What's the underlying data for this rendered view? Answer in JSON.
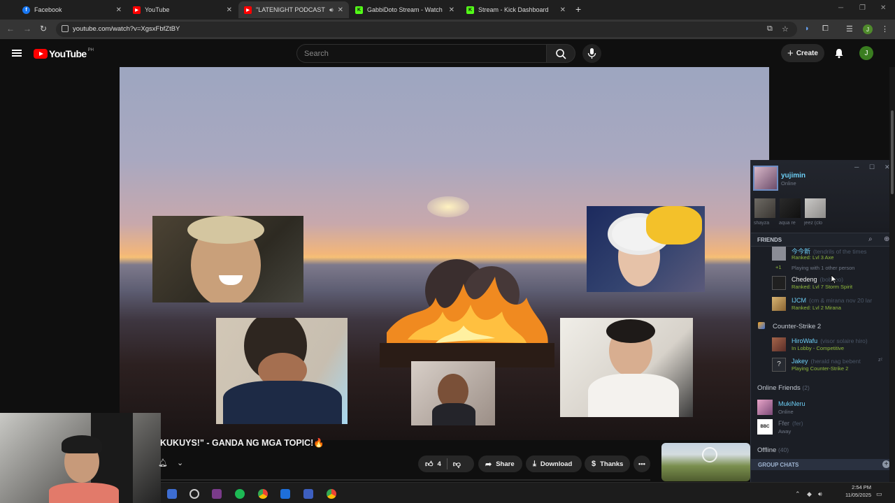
{
  "browser": {
    "tabs": [
      {
        "title": "Facebook",
        "color": "#1877f2",
        "glyph": "f"
      },
      {
        "title": "YouTube",
        "color": "#ff0000",
        "glyph": "▶"
      },
      {
        "title": "\"LATENIGHT PODCAST wit",
        "color": "#ff0000",
        "glyph": "▶"
      },
      {
        "title": "GabbiDoto Stream - Watch Liv",
        "color": "#53fc18",
        "glyph": "K"
      },
      {
        "title": "Stream - Kick Dashboard",
        "color": "#53fc18",
        "glyph": "K"
      }
    ],
    "url": "youtube.com/watch?v=XgsxFbfZtBY",
    "profile_initial": "J"
  },
  "youtube": {
    "country_code": "PH",
    "logo_text": "YouTube",
    "search_placeholder": "Search",
    "create_label": "Create",
    "avatar_initial": "J",
    "video_title": "KUKUYS!\" - GANDA NG MGA TOPIC!🔥",
    "like_count": "4",
    "share_label": "Share",
    "download_label": "Download",
    "thanks_label": "Thanks"
  },
  "steam": {
    "user": {
      "name": "yujimin",
      "status": "Online"
    },
    "recent": [
      "shayza",
      "aqua re",
      "jeez (clo"
    ],
    "friends_label": "FRIENDS",
    "in_game_rows": [
      {
        "name": "今今新",
        "nick": "(tendrils of the times",
        "status": "Ranked: Lvl 3 Axe"
      },
      {
        "extra": "+1",
        "note": "Playing with 1 other person"
      },
      {
        "name": "Chedeng",
        "nick": "(bob leo)",
        "status": "Ranked: Lvl 7 Storm Spirit"
      },
      {
        "name": "IJCM",
        "nick": "(cm & mirana nov 20 lar",
        "status": "Ranked: Lvl 2 Mirana"
      }
    ],
    "cs_group": "Counter-Strike 2",
    "cs_rows": [
      {
        "name": "HiroWafu",
        "nick": "(visor solaire hiro)",
        "status": "In Lobby - Competitive"
      },
      {
        "name": "Jakey",
        "nick": "(herald nag bebent",
        "status": "Playing Counter-Strike 2"
      }
    ],
    "online_group": "Online Friends",
    "online_count": "(2)",
    "online_rows": [
      {
        "name": "MukiNeru",
        "status": "Online"
      },
      {
        "name": "Ffer",
        "nick": "(fer)",
        "status": "Away"
      }
    ],
    "offline_group": "Offline",
    "offline_count": "(40)",
    "group_chats": "GROUP CHATS"
  },
  "taskbar": {
    "time": "2:54 PM",
    "date": "11/05/2025"
  }
}
